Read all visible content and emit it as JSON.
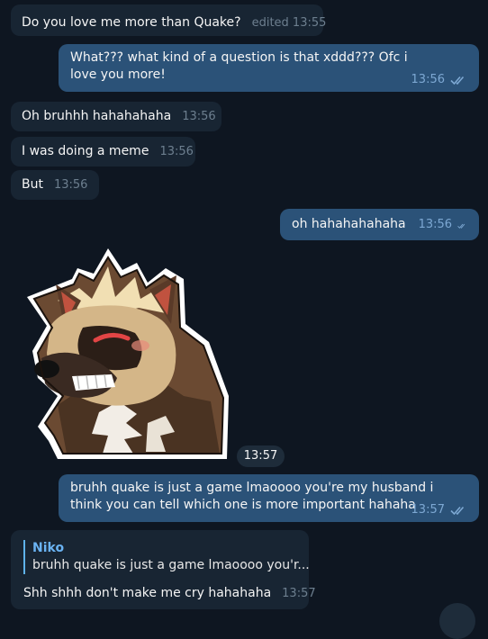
{
  "messages": [
    {
      "text": "Do you love me more than Quake?",
      "time": "edited 13:55"
    },
    {
      "text": "What??? what kind of a question is that xddd??? Ofc i love you more!",
      "time": "13:56"
    },
    {
      "text": "Oh bruhhh hahahahaha",
      "time": "13:56"
    },
    {
      "text": "I was doing a meme",
      "time": "13:56"
    },
    {
      "text": "But",
      "time": "13:56"
    },
    {
      "text": "oh hahahahahaha",
      "time": "13:56"
    },
    {
      "text": "",
      "time": "13:57"
    },
    {
      "text": "bruhh quake is just a game lmaoooo you're my husband i think you can tell which one is more important hahaha",
      "time": "13:57"
    },
    {
      "text": "Shh shhh don't make me cry hahahaha",
      "time": "13:57",
      "reply_name": "Niko",
      "reply_text": "bruhh quake is just a game lmaoooo you'r..."
    }
  ],
  "colors": {
    "background": "#0e1621",
    "incoming": "#182533",
    "outgoing": "#2b5278",
    "accent": "#6ab3f3"
  },
  "icons": {
    "read_receipt": "double-check-icon",
    "sticker": "hyena-grin-sticker"
  }
}
